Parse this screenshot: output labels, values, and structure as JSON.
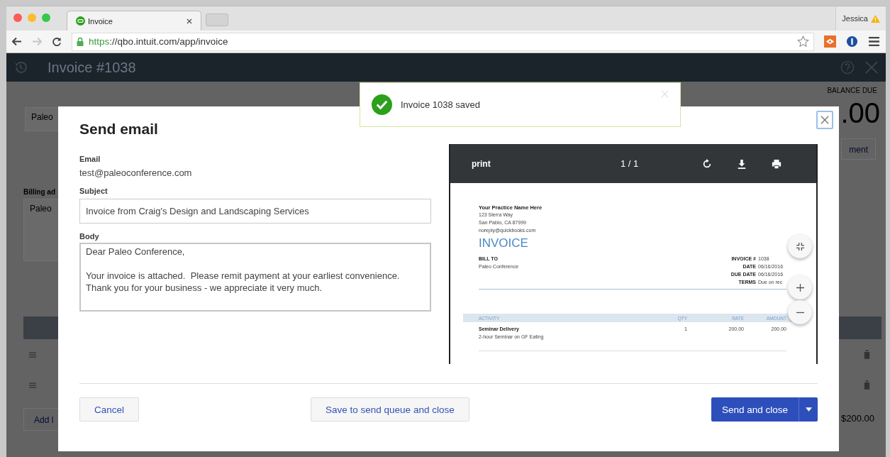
{
  "browser": {
    "tab_title": "Invoice",
    "url_scheme": "https",
    "url_rest": "://qbo.intuit.com/app/invoice",
    "profile": "Jessica",
    "nav_buttons": [
      {
        "kind": "back",
        "disabled": false
      },
      {
        "kind": "forward",
        "disabled": true
      },
      {
        "kind": "reload",
        "disabled": false
      }
    ]
  },
  "app_header": {
    "title": "Invoice #1038"
  },
  "background": {
    "customer_field": "Paleo",
    "billing_label": "Billing ad",
    "billing_value": "Paleo",
    "add_button": "Add l",
    "balance_label": "BALANCE DUE",
    "balance_amount": ".00",
    "payment_button": "ment",
    "total": "$200.00"
  },
  "toast": {
    "message": "Invoice 1038 saved"
  },
  "modal": {
    "title": "Send email",
    "email_label": "Email",
    "email_value": "test@paleoconference.com",
    "subject_label": "Subject",
    "subject_value": "Invoice from Craig's Design and Landscaping Services",
    "body_label": "Body",
    "body_value": "Dear Paleo Conference,\n\nYour invoice is attached.  Please remit payment at your earliest convenience.\nThank you for your business - we appreciate it very much.",
    "preview": {
      "toolbar_title": "print",
      "page_count": "1 / 1",
      "document": {
        "company": "Your Practice Name Here",
        "address_lines": [
          "123 Sierra Way",
          "San Pablo, CA  87999",
          "noreply@quickbooks.com"
        ],
        "heading": "INVOICE",
        "bill_to_label": "BILL TO",
        "bill_to_value": "Paleo Conference",
        "meta": [
          {
            "label": "INVOICE #",
            "value": "1038"
          },
          {
            "label": "DATE",
            "value": "06/16/2016"
          },
          {
            "label": "DUE DATE",
            "value": "06/16/2016"
          },
          {
            "label": "TERMS",
            "value": "Due on rec"
          }
        ],
        "columns": [
          "ACTIVITY",
          "QTY",
          "RATE",
          "AMOUNT"
        ],
        "rows": [
          {
            "activity": "Seminar Delivery",
            "description": "2-hour Seminar on GF Eating",
            "qty": "1",
            "rate": "200.00",
            "amount": "200.00"
          }
        ]
      }
    },
    "buttons": [
      {
        "label": "Cancel",
        "kind": "secondary"
      },
      {
        "label": "Save to send queue and close",
        "kind": "secondary"
      },
      {
        "label": "Send and close",
        "kind": "primary"
      }
    ]
  }
}
